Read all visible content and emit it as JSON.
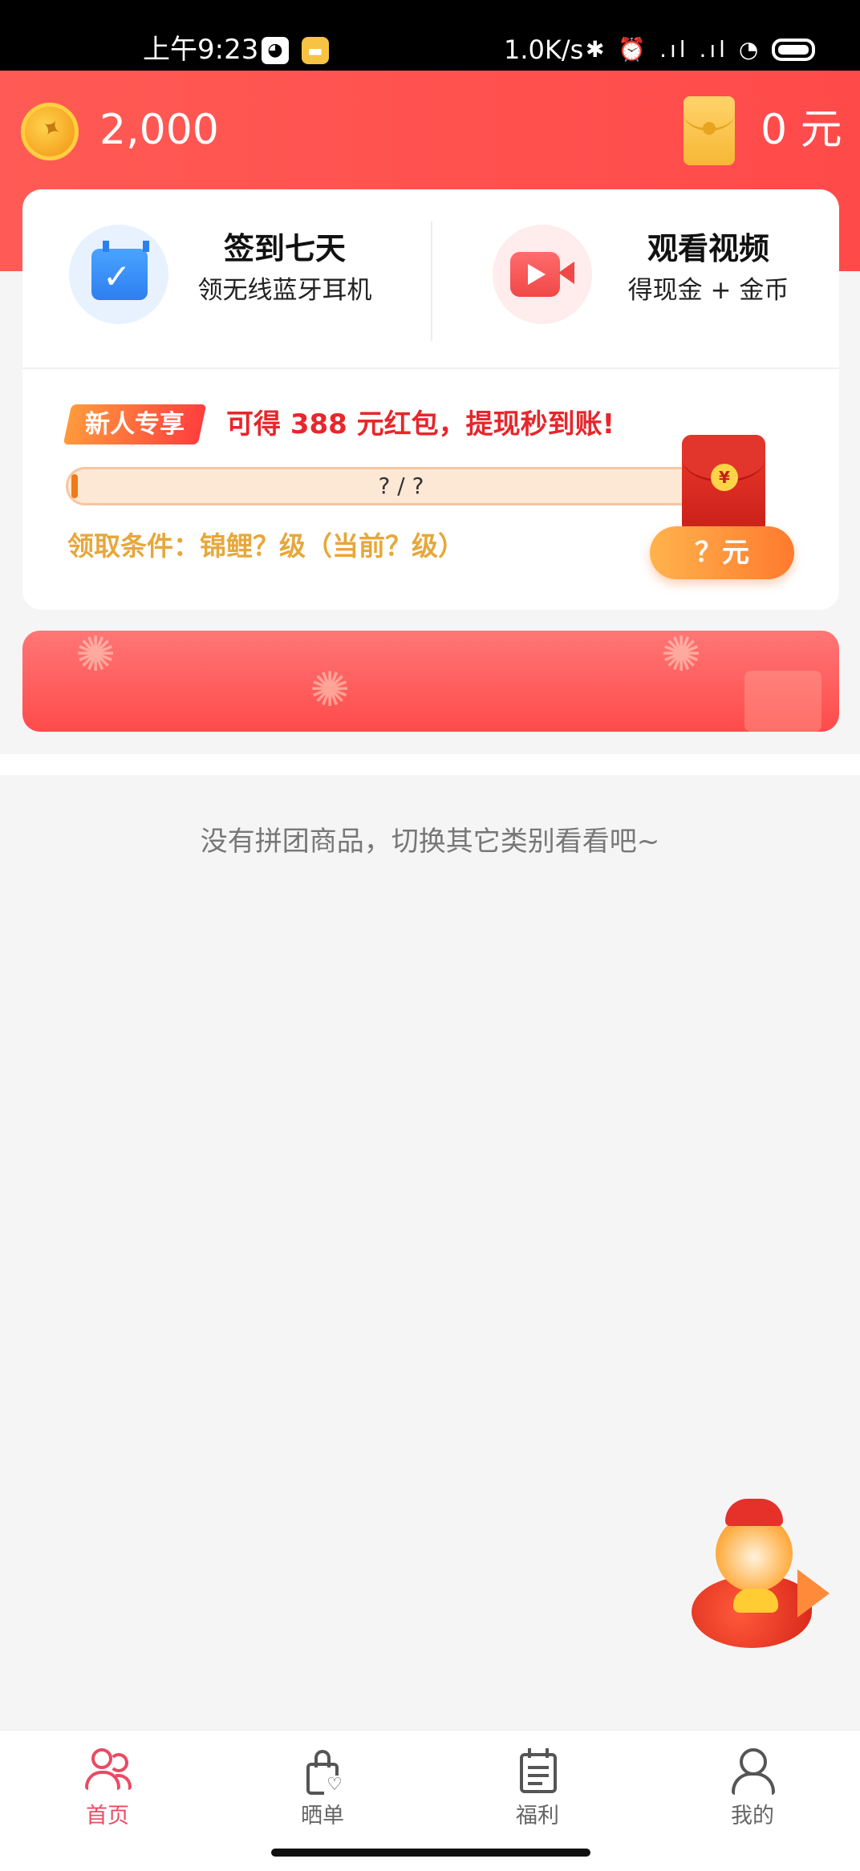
{
  "status_bar": {
    "time": "上午9:23",
    "qq_icon": "qq-icon",
    "message_icon": "message-icon",
    "network_speed": "1.0K/s",
    "status_icons": "✱ ⏰ .ıl .ıl ◔"
  },
  "header": {
    "coin_count": "2,000",
    "cash_amount": "0 元"
  },
  "tasks": {
    "checkin": {
      "title": "签到七天",
      "subtitle": "领无线蓝牙耳机",
      "icon": "calendar-check-icon"
    },
    "video": {
      "title": "观看视频",
      "subtitle": "得现金 + 金币",
      "icon": "video-camera-icon"
    }
  },
  "newcomer": {
    "badge": "新人专享",
    "promo": "可得 388 元红包，提现秒到账!",
    "progress_label": "? / ?",
    "progress_fraction": 0.01,
    "condition": "领取条件：锦鲤？级（当前？级）",
    "redpacket_symbol": "¥",
    "claim_button": "？元"
  },
  "empty_state": {
    "message": "没有拼团商品，切换其它类别看看吧~"
  },
  "tab_bar": {
    "tabs": [
      {
        "label": "首页",
        "icon": "people-icon",
        "active": true
      },
      {
        "label": "晒单",
        "icon": "shopping-bag-heart-icon",
        "active": false
      },
      {
        "label": "福利",
        "icon": "calendar-list-icon",
        "active": false
      },
      {
        "label": "我的",
        "icon": "person-icon",
        "active": false
      }
    ]
  },
  "colors": {
    "brand_red": "#ff4a4a",
    "active_tab": "#e94b62",
    "promo_red": "#e8262b",
    "condition_gold": "#e7a73a",
    "claim_orange": "#ff7a2e"
  }
}
